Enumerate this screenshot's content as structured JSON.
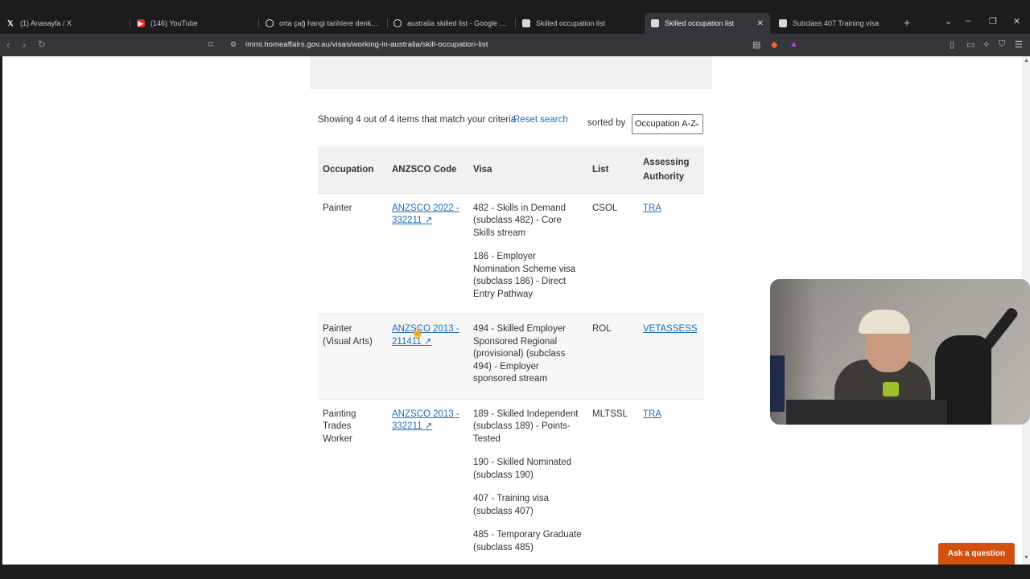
{
  "tabs": [
    {
      "title": "(1) Anasayfa / X",
      "icon": "x-logo-icon"
    },
    {
      "title": "(146) YouTube",
      "icon": "youtube-icon"
    },
    {
      "title": "orta çağ hangi tarihlere denk geliyo",
      "icon": "google-icon"
    },
    {
      "title": "australia skilled list - Google Search",
      "icon": "google-icon"
    },
    {
      "title": "Skilled occupation list",
      "icon": "gov-icon"
    },
    {
      "title": "Skilled occupation list",
      "icon": "gov-icon",
      "active": true
    },
    {
      "title": "Subclass 407 Training visa",
      "icon": "gov-icon"
    }
  ],
  "address_bar": {
    "url": "immi.homeaffairs.gov.au/visas/working-in-australia/skill-occupation-list"
  },
  "results": {
    "summary": "Showing 4 out of 4 items that match your criteria",
    "reset_label": "Reset search",
    "sorted_by_label": "sorted by",
    "sort_value": "Occupation A-Z"
  },
  "table": {
    "headers": [
      "Occupation",
      "ANZSCO Code",
      "Visa",
      "List",
      "Assessing Authority"
    ],
    "rows": [
      {
        "occupation": "Painter",
        "anzsco": "ANZSCO 2022 - 332211 ↗",
        "visas": [
          "482 - Skills in Demand (subclass 482) - Core Skills stream",
          "186 - Employer Nomination Scheme visa (subclass 186) - Direct Entry Pathway"
        ],
        "list": "CSOL",
        "authority": "TRA"
      },
      {
        "occupation": "Painter (Visual Arts)",
        "anzsco": "ANZSCO 2013 - 211411 ↗",
        "visas": [
          "494 - Skilled Employer Sponsored Regional (provisional) (subclass 494) - Employer sponsored stream"
        ],
        "list": "ROL",
        "authority": "VETASSESS"
      },
      {
        "occupation": "Painting Trades Worker",
        "anzsco": "ANZSCO 2013 - 332211 ↗",
        "visas": [
          "189 - Skilled Independent (subclass 189) - Points-Tested",
          "190 - Skilled Nominated (subclass 190)",
          "407 - Training visa (subclass 407)",
          "485 - Temporary Graduate (subclass 485)"
        ],
        "list": "MLTSSL",
        "authority": "TRA"
      }
    ]
  },
  "ask_button": {
    "label": "Ask a question"
  }
}
